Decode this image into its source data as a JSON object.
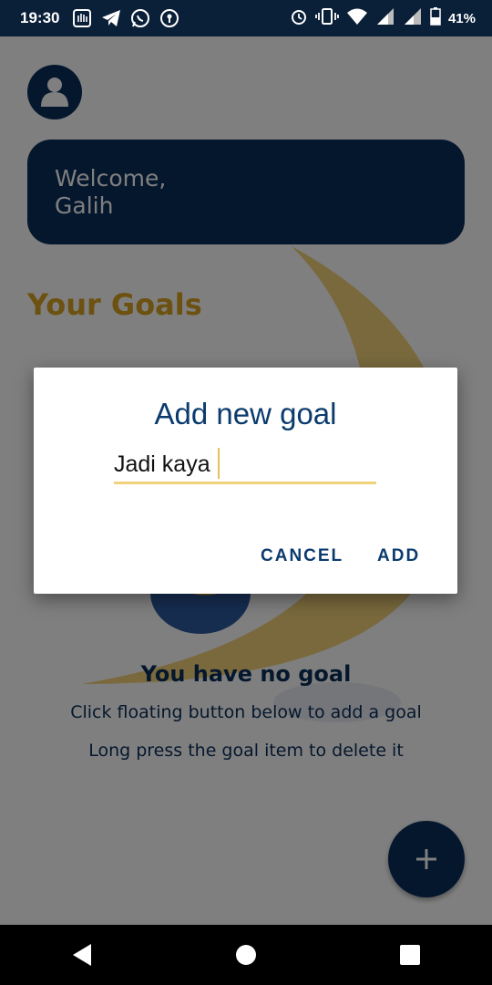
{
  "status_bar": {
    "time": "19:30",
    "battery": "41%",
    "left_icons": [
      "hand-app-icon",
      "telegram-icon",
      "whatsapp-icon",
      "keyhole-icon"
    ],
    "right_icons": [
      "alarm-icon",
      "vibrate-icon",
      "wifi-icon",
      "signal-icon",
      "signal-icon",
      "battery-icon"
    ]
  },
  "app": {
    "welcome_text": "Welcome,\nGalih",
    "goals_title": "Your Goals",
    "empty_title": "You have no goal",
    "empty_hint_1": "Click floating button below to add a goal",
    "empty_hint_2": "Long press the goal item to delete it",
    "fab_label": "+"
  },
  "dialog": {
    "title": "Add new goal",
    "input_value": "Jadi kaya",
    "cancel_label": "CANCEL",
    "add_label": "ADD"
  },
  "colors": {
    "primary": "#0b2e5b",
    "accent": "#d9a321",
    "input_underline": "#f0d27a"
  },
  "nav_bar": {
    "items": [
      "back-icon",
      "home-icon",
      "recents-icon"
    ]
  }
}
